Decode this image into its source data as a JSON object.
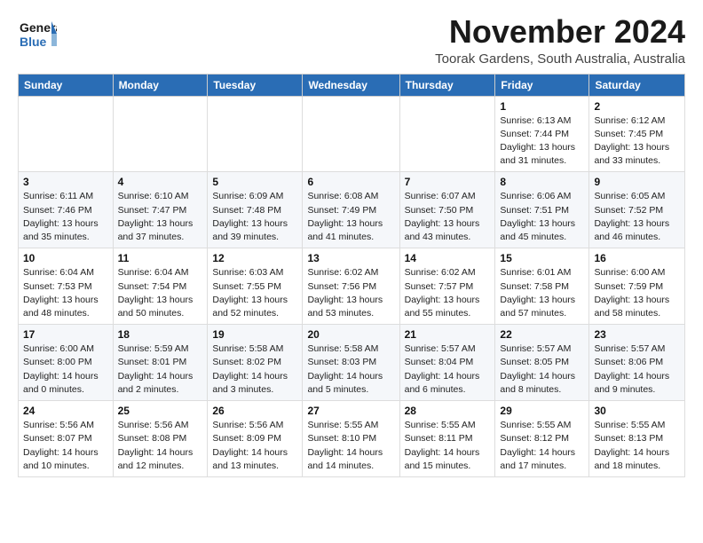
{
  "header": {
    "logo_general": "General",
    "logo_blue": "Blue",
    "month_title": "November 2024",
    "location": "Toorak Gardens, South Australia, Australia"
  },
  "days_of_week": [
    "Sunday",
    "Monday",
    "Tuesday",
    "Wednesday",
    "Thursday",
    "Friday",
    "Saturday"
  ],
  "weeks": [
    [
      {
        "day": "",
        "info": ""
      },
      {
        "day": "",
        "info": ""
      },
      {
        "day": "",
        "info": ""
      },
      {
        "day": "",
        "info": ""
      },
      {
        "day": "",
        "info": ""
      },
      {
        "day": "1",
        "info": "Sunrise: 6:13 AM\nSunset: 7:44 PM\nDaylight: 13 hours and 31 minutes."
      },
      {
        "day": "2",
        "info": "Sunrise: 6:12 AM\nSunset: 7:45 PM\nDaylight: 13 hours and 33 minutes."
      }
    ],
    [
      {
        "day": "3",
        "info": "Sunrise: 6:11 AM\nSunset: 7:46 PM\nDaylight: 13 hours and 35 minutes."
      },
      {
        "day": "4",
        "info": "Sunrise: 6:10 AM\nSunset: 7:47 PM\nDaylight: 13 hours and 37 minutes."
      },
      {
        "day": "5",
        "info": "Sunrise: 6:09 AM\nSunset: 7:48 PM\nDaylight: 13 hours and 39 minutes."
      },
      {
        "day": "6",
        "info": "Sunrise: 6:08 AM\nSunset: 7:49 PM\nDaylight: 13 hours and 41 minutes."
      },
      {
        "day": "7",
        "info": "Sunrise: 6:07 AM\nSunset: 7:50 PM\nDaylight: 13 hours and 43 minutes."
      },
      {
        "day": "8",
        "info": "Sunrise: 6:06 AM\nSunset: 7:51 PM\nDaylight: 13 hours and 45 minutes."
      },
      {
        "day": "9",
        "info": "Sunrise: 6:05 AM\nSunset: 7:52 PM\nDaylight: 13 hours and 46 minutes."
      }
    ],
    [
      {
        "day": "10",
        "info": "Sunrise: 6:04 AM\nSunset: 7:53 PM\nDaylight: 13 hours and 48 minutes."
      },
      {
        "day": "11",
        "info": "Sunrise: 6:04 AM\nSunset: 7:54 PM\nDaylight: 13 hours and 50 minutes."
      },
      {
        "day": "12",
        "info": "Sunrise: 6:03 AM\nSunset: 7:55 PM\nDaylight: 13 hours and 52 minutes."
      },
      {
        "day": "13",
        "info": "Sunrise: 6:02 AM\nSunset: 7:56 PM\nDaylight: 13 hours and 53 minutes."
      },
      {
        "day": "14",
        "info": "Sunrise: 6:02 AM\nSunset: 7:57 PM\nDaylight: 13 hours and 55 minutes."
      },
      {
        "day": "15",
        "info": "Sunrise: 6:01 AM\nSunset: 7:58 PM\nDaylight: 13 hours and 57 minutes."
      },
      {
        "day": "16",
        "info": "Sunrise: 6:00 AM\nSunset: 7:59 PM\nDaylight: 13 hours and 58 minutes."
      }
    ],
    [
      {
        "day": "17",
        "info": "Sunrise: 6:00 AM\nSunset: 8:00 PM\nDaylight: 14 hours and 0 minutes."
      },
      {
        "day": "18",
        "info": "Sunrise: 5:59 AM\nSunset: 8:01 PM\nDaylight: 14 hours and 2 minutes."
      },
      {
        "day": "19",
        "info": "Sunrise: 5:58 AM\nSunset: 8:02 PM\nDaylight: 14 hours and 3 minutes."
      },
      {
        "day": "20",
        "info": "Sunrise: 5:58 AM\nSunset: 8:03 PM\nDaylight: 14 hours and 5 minutes."
      },
      {
        "day": "21",
        "info": "Sunrise: 5:57 AM\nSunset: 8:04 PM\nDaylight: 14 hours and 6 minutes."
      },
      {
        "day": "22",
        "info": "Sunrise: 5:57 AM\nSunset: 8:05 PM\nDaylight: 14 hours and 8 minutes."
      },
      {
        "day": "23",
        "info": "Sunrise: 5:57 AM\nSunset: 8:06 PM\nDaylight: 14 hours and 9 minutes."
      }
    ],
    [
      {
        "day": "24",
        "info": "Sunrise: 5:56 AM\nSunset: 8:07 PM\nDaylight: 14 hours and 10 minutes."
      },
      {
        "day": "25",
        "info": "Sunrise: 5:56 AM\nSunset: 8:08 PM\nDaylight: 14 hours and 12 minutes."
      },
      {
        "day": "26",
        "info": "Sunrise: 5:56 AM\nSunset: 8:09 PM\nDaylight: 14 hours and 13 minutes."
      },
      {
        "day": "27",
        "info": "Sunrise: 5:55 AM\nSunset: 8:10 PM\nDaylight: 14 hours and 14 minutes."
      },
      {
        "day": "28",
        "info": "Sunrise: 5:55 AM\nSunset: 8:11 PM\nDaylight: 14 hours and 15 minutes."
      },
      {
        "day": "29",
        "info": "Sunrise: 5:55 AM\nSunset: 8:12 PM\nDaylight: 14 hours and 17 minutes."
      },
      {
        "day": "30",
        "info": "Sunrise: 5:55 AM\nSunset: 8:13 PM\nDaylight: 14 hours and 18 minutes."
      }
    ]
  ]
}
